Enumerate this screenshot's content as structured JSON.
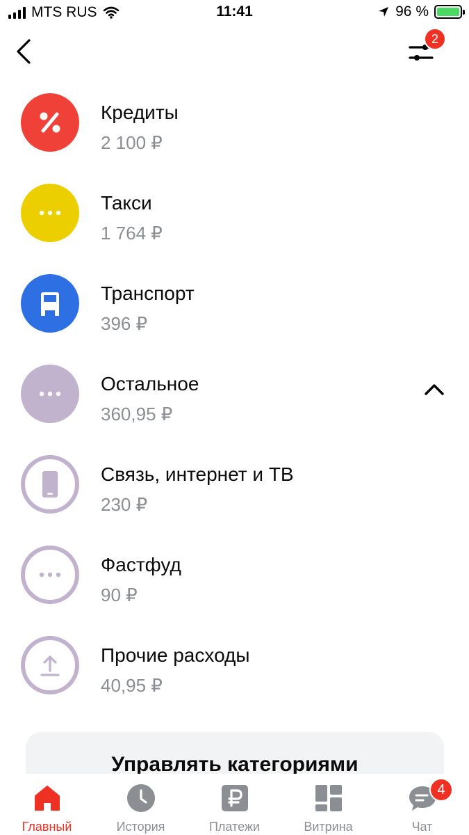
{
  "status_bar": {
    "carrier": "MTS RUS",
    "time": "11:41",
    "battery_percent": "96 %",
    "battery_level": 0.96
  },
  "header": {
    "filter_badge": "2"
  },
  "categories": [
    {
      "name": "Кредиты",
      "amount": "2 100 ₽",
      "icon": "percent-icon",
      "color": "#ef4137"
    },
    {
      "name": "Такси",
      "amount": "1 764 ₽",
      "icon": "dots-icon",
      "color": "#eccf00"
    },
    {
      "name": "Транспорт",
      "amount": "396 ₽",
      "icon": "bus-icon",
      "color": "#2f6fe4"
    },
    {
      "name": "Остальное",
      "amount": "360,95 ₽",
      "icon": "dots-icon",
      "color": "#c1b2cd",
      "expanded": true
    },
    {
      "name": "Связь, интернет и ТВ",
      "amount": "230 ₽",
      "icon": "phone-icon",
      "color": "#c1b2cd"
    },
    {
      "name": "Фастфуд",
      "amount": "90 ₽",
      "icon": "dots-icon",
      "color": "#c1b2cd"
    },
    {
      "name": "Прочие расходы",
      "amount": "40,95 ₽",
      "icon": "upload-icon",
      "color": "#c1b2cd"
    }
  ],
  "manage_button": "Управлять категориями",
  "tabbar": {
    "tabs": [
      {
        "label": "Главный",
        "icon": "home-icon",
        "active": true
      },
      {
        "label": "История",
        "icon": "clock-icon"
      },
      {
        "label": "Платежи",
        "icon": "ruble-icon"
      },
      {
        "label": "Витрина",
        "icon": "grid-icon"
      },
      {
        "label": "Чат",
        "icon": "chat-icon"
      }
    ],
    "chat_badge": "4"
  },
  "colors": {
    "accent": "#ef3124",
    "muted": "#8b8e92"
  }
}
